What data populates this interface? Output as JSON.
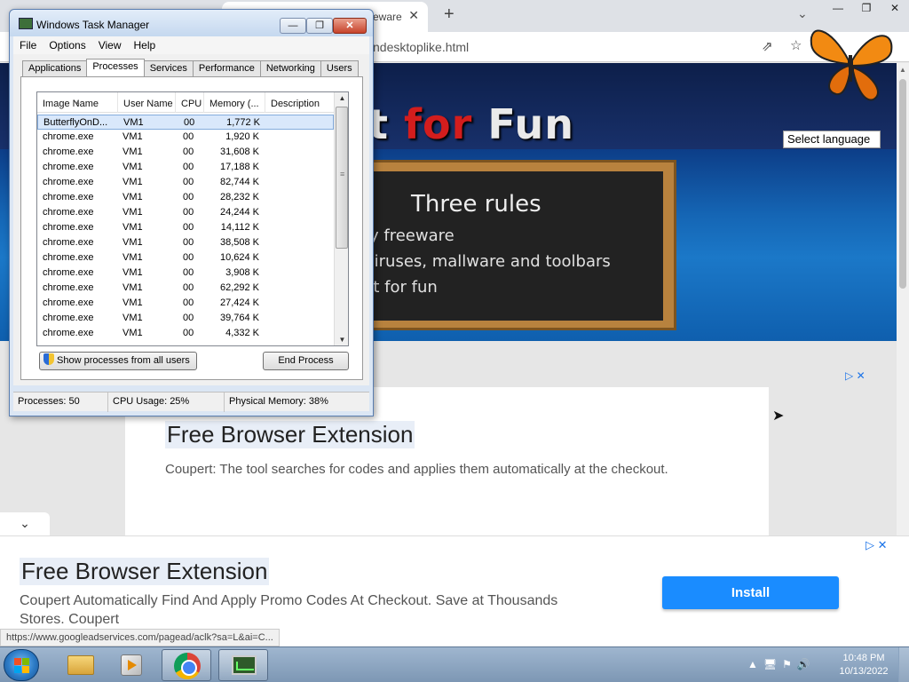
{
  "browser": {
    "tab_title": "eware",
    "url_fragment": "ndesktoplike.html",
    "close_glyph": "✕",
    "new_tab_glyph": "+",
    "tabs_menu_glyph": "⌄",
    "window_controls": [
      "—",
      "❐",
      "✕"
    ]
  },
  "site": {
    "hero_title_a": "t",
    "hero_title_for": "for",
    "hero_title_b": "Fun",
    "board_title": "Three rules",
    "board_lines": [
      "ly freeware",
      " viruses, mallware and toolbars",
      "st for fun"
    ],
    "select_language": "Select language"
  },
  "ad_inline": {
    "title": "Free Browser Extension",
    "description": "Coupert: The tool searches for codes and applies them automatically at the checkout.",
    "icons": "▷ ✕"
  },
  "ad_bottom": {
    "collapse_glyph": "⌄",
    "title": "Free Browser Extension",
    "description": "Coupert Automatically Find And Apply Promo Codes At Checkout. Save at Thousands Stores. Coupert",
    "install_label": "Install",
    "icons": "▷ ✕"
  },
  "status_url": "https://www.googleadservices.com/pagead/aclk?sa=L&ai=C...",
  "task_manager": {
    "title": "Windows Task Manager",
    "title_buttons": [
      "—",
      "❐",
      "✕"
    ],
    "menu": [
      "File",
      "Options",
      "View",
      "Help"
    ],
    "tabs": [
      "Applications",
      "Processes",
      "Services",
      "Performance",
      "Networking",
      "Users"
    ],
    "active_tab": "Processes",
    "columns": [
      "Image Name",
      "User Name",
      "CPU",
      "Memory (...",
      "Description"
    ],
    "rows": [
      {
        "name": "ButterflyOnD...",
        "user": "VM1",
        "cpu": "00",
        "mem": "1,772 K"
      },
      {
        "name": "chrome.exe",
        "user": "VM1",
        "cpu": "00",
        "mem": "1,920 K"
      },
      {
        "name": "chrome.exe",
        "user": "VM1",
        "cpu": "00",
        "mem": "31,608 K"
      },
      {
        "name": "chrome.exe",
        "user": "VM1",
        "cpu": "00",
        "mem": "17,188 K"
      },
      {
        "name": "chrome.exe",
        "user": "VM1",
        "cpu": "00",
        "mem": "82,744 K"
      },
      {
        "name": "chrome.exe",
        "user": "VM1",
        "cpu": "00",
        "mem": "28,232 K"
      },
      {
        "name": "chrome.exe",
        "user": "VM1",
        "cpu": "00",
        "mem": "24,244 K"
      },
      {
        "name": "chrome.exe",
        "user": "VM1",
        "cpu": "00",
        "mem": "14,112 K"
      },
      {
        "name": "chrome.exe",
        "user": "VM1",
        "cpu": "00",
        "mem": "38,508 K"
      },
      {
        "name": "chrome.exe",
        "user": "VM1",
        "cpu": "00",
        "mem": "10,624 K"
      },
      {
        "name": "chrome.exe",
        "user": "VM1",
        "cpu": "00",
        "mem": "3,908 K"
      },
      {
        "name": "chrome.exe",
        "user": "VM1",
        "cpu": "00",
        "mem": "62,292 K"
      },
      {
        "name": "chrome.exe",
        "user": "VM1",
        "cpu": "00",
        "mem": "27,424 K"
      },
      {
        "name": "chrome.exe",
        "user": "VM1",
        "cpu": "00",
        "mem": "39,764 K"
      },
      {
        "name": "chrome.exe",
        "user": "VM1",
        "cpu": "00",
        "mem": "4,332 K"
      }
    ],
    "show_all_label": "Show processes from all users",
    "end_process_label": "End Process",
    "status": {
      "processes": "Processes: 50",
      "cpu": "CPU Usage: 25%",
      "memory": "Physical Memory: 38%"
    }
  },
  "taskbar": {
    "clock_time": "10:48 PM",
    "clock_date": "10/13/2022",
    "tray_icons": [
      "▲",
      "🖥",
      "⚑",
      "🔊"
    ]
  }
}
